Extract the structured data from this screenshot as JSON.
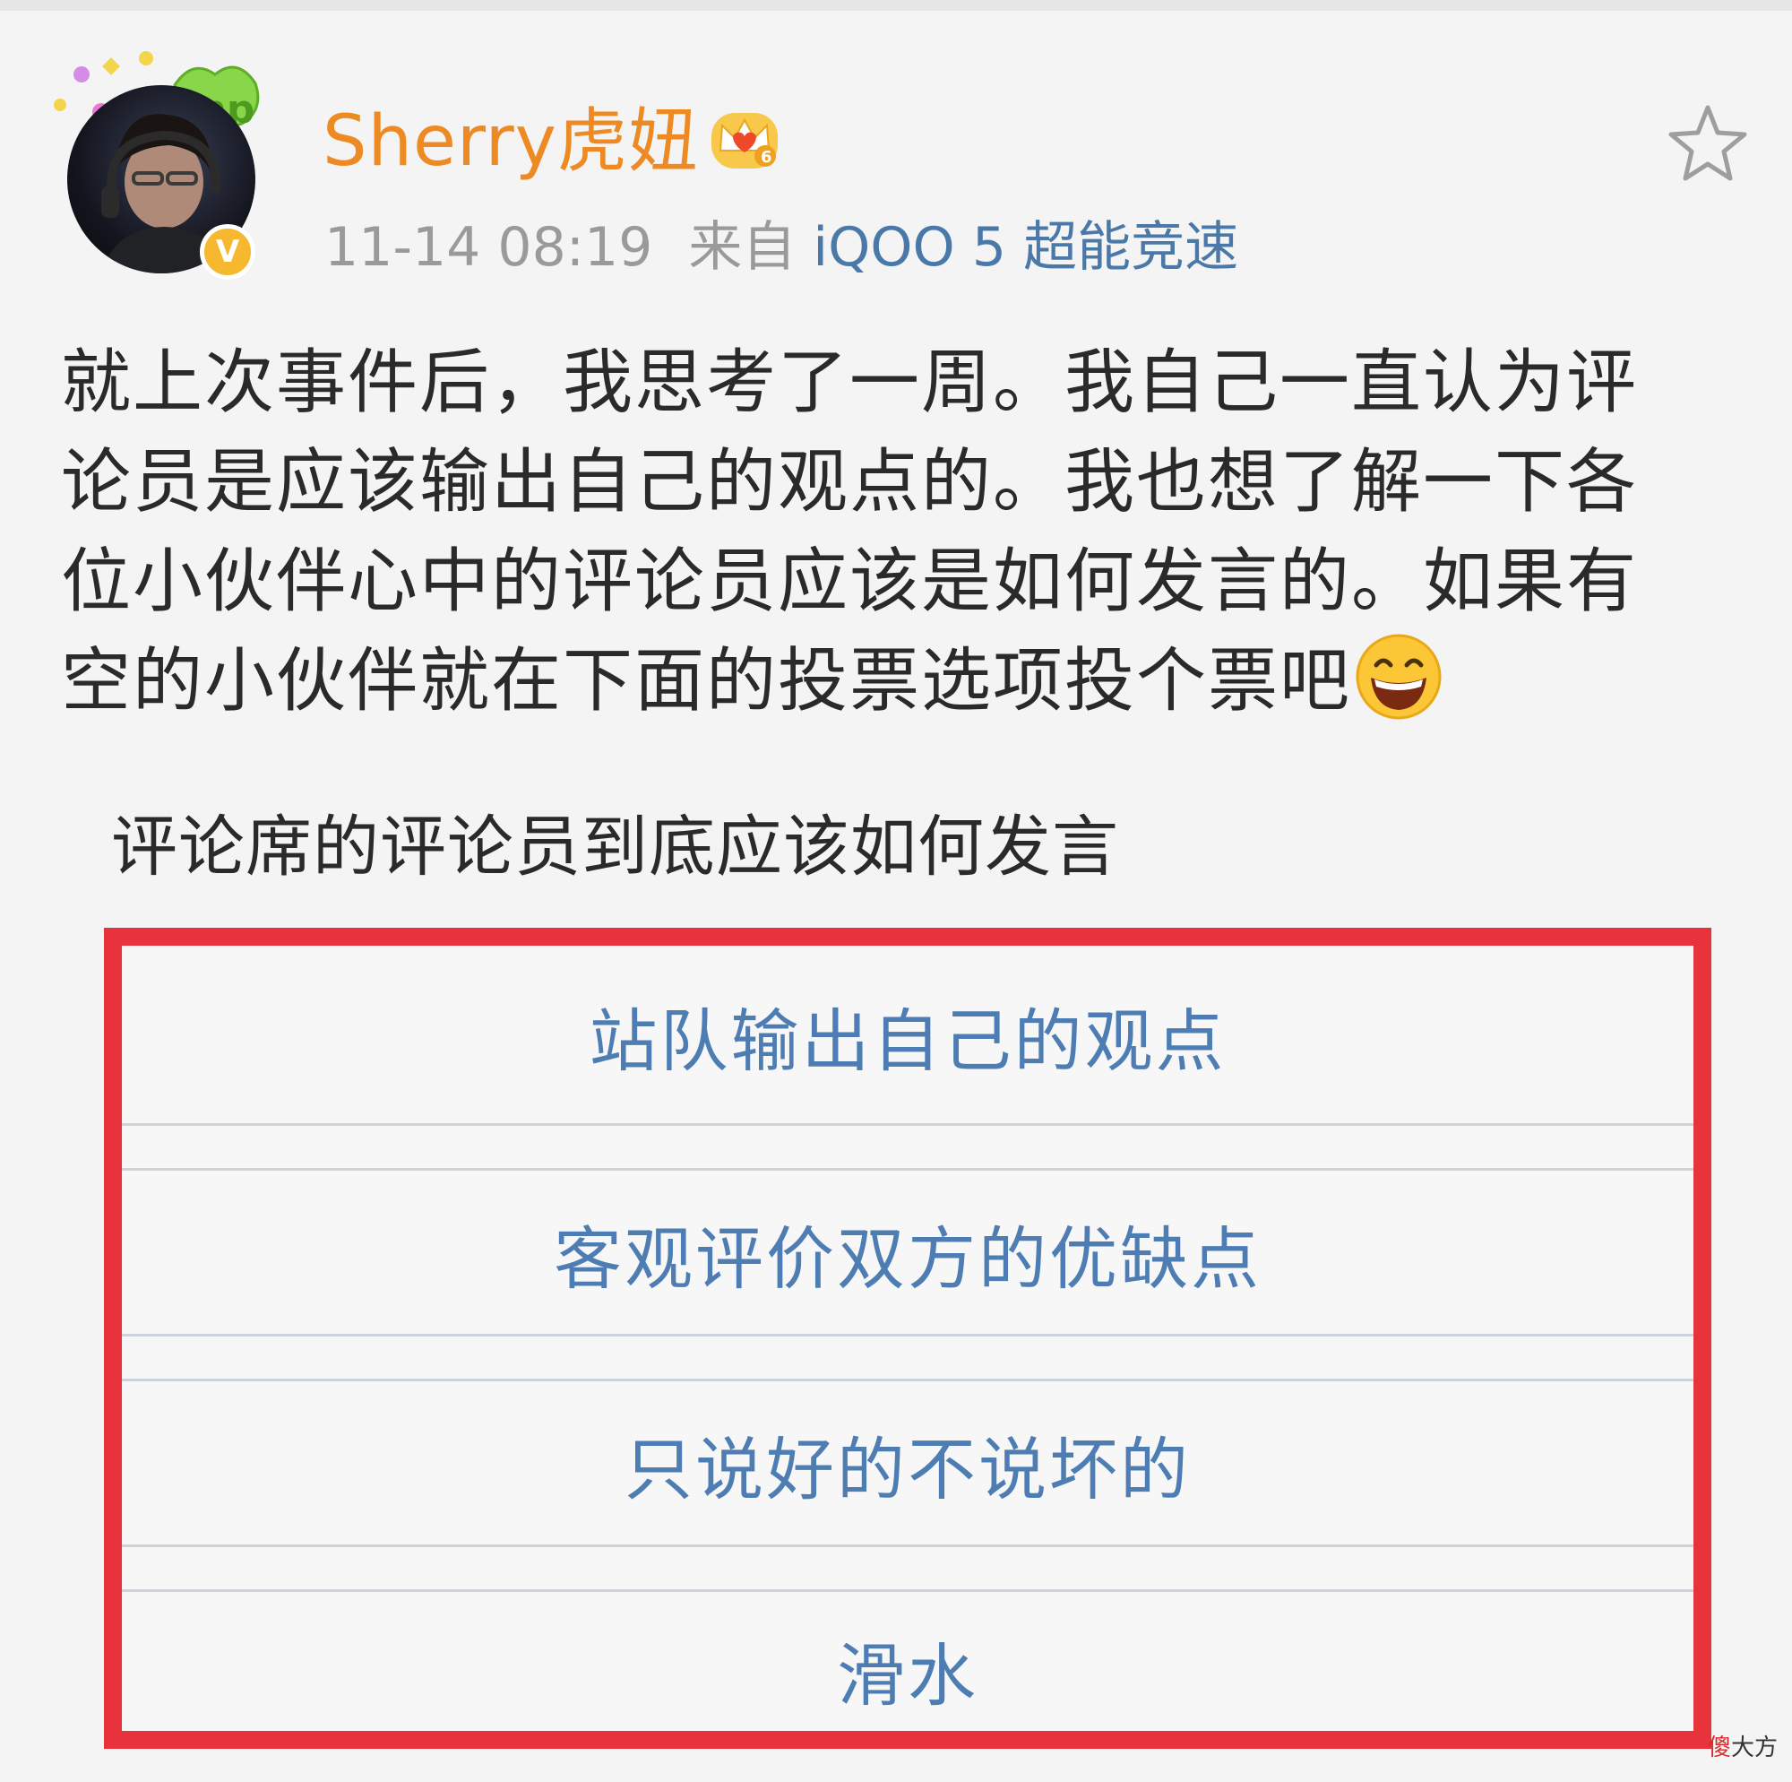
{
  "post": {
    "username": "Sherry虎妞",
    "timestamp": "11-14 08:19",
    "source_prefix": "来自",
    "source_device": "iQOO 5 超能竞速",
    "avatar_badge": "V",
    "body_lines": [
      "就上次事件后，我思考了一周。我自己一直认为评",
      "论员是应该输出自己的观点的。我也想了解一下各",
      "位小伙伴心中的评论员应该是如何发言的。如果有",
      "空的小伙伴就在下面的投票选项投个票吧"
    ]
  },
  "poll": {
    "title": "评论席的评论员到底应该如何发言",
    "options": [
      "站队输出自己的观点",
      "客观评价双方的优缺点",
      "只说好的不说坏的",
      "滑水"
    ]
  },
  "watermark": {
    "accent": "傻",
    "rest": "大方"
  },
  "icons": {
    "favorite": "star-outline-icon",
    "member_level": "crown-icon",
    "verified": "verified-v-icon",
    "emoji": "grinning-face-icon"
  },
  "colors": {
    "username": "#ee8a24",
    "link": "#4a78a8",
    "poll_option": "#4d7db2",
    "highlight_box": "#e8323c",
    "verified_badge": "#f5b82e"
  }
}
